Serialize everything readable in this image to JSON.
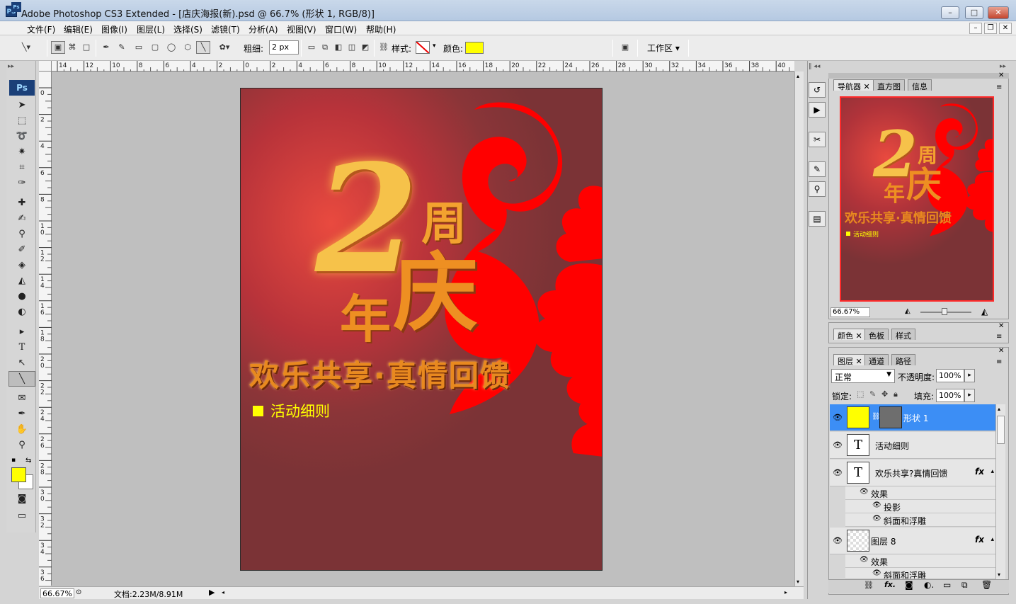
{
  "window": {
    "app_icon": "PS",
    "title": "Adobe Photoshop CS3 Extended - [店庆海报(新).psd @ 66.7% (形状 1, RGB/8)]",
    "min_label": "–",
    "max_label": "□",
    "close_label": "✕"
  },
  "menu": {
    "items": [
      "文件(F)",
      "编辑(E)",
      "图像(I)",
      "图层(L)",
      "选择(S)",
      "滤镜(T)",
      "分析(A)",
      "视图(V)",
      "窗口(W)",
      "帮助(H)"
    ],
    "doc_buttons": [
      "–",
      "❐",
      "✕"
    ]
  },
  "options": {
    "weight_label": "粗细:",
    "weight_value": "2 px",
    "style_label": "样式:",
    "color_label": "颜色:",
    "color_swatch": "#ffff00",
    "workspace_label": "工作区 ▾"
  },
  "ruler": {
    "h_ticks": [
      "14",
      "12",
      "10",
      "8",
      "6",
      "4",
      "2",
      "0",
      "2",
      "4",
      "6",
      "8",
      "10",
      "12",
      "14",
      "16",
      "18",
      "20",
      "22",
      "24",
      "26",
      "28",
      "30",
      "32",
      "34",
      "36",
      "38",
      "40"
    ],
    "v_ticks": [
      "0",
      "2",
      "4",
      "6",
      "8",
      "10",
      "12",
      "14",
      "16",
      "18",
      "20",
      "22",
      "24",
      "26",
      "28",
      "30",
      "32",
      "34",
      "36"
    ]
  },
  "poster": {
    "headline_number": "2",
    "headline_zhou": "周",
    "headline_nian": "年",
    "headline_qing": "庆",
    "slogan": "欢乐共享·真情回馈",
    "detail_text": "活动细则",
    "bg_color": "#8a3538",
    "cloud_color": "#ff0000",
    "gold_color": "#f5a623"
  },
  "status": {
    "zoom": "66.67%",
    "doc_info": "文档:2.23M/8.91M"
  },
  "navigator": {
    "tabs": [
      "导航器",
      "直方图",
      "信息"
    ],
    "zoom": "66.67%"
  },
  "color_panel": {
    "tabs": [
      "颜色",
      "色板",
      "样式"
    ]
  },
  "layers_panel": {
    "tabs": [
      "图层",
      "通道",
      "路径"
    ],
    "blend_mode": "正常",
    "opacity_label": "不透明度:",
    "opacity_value": "100%",
    "lock_label": "锁定:",
    "fill_label": "填充:",
    "fill_value": "100%",
    "layers": [
      {
        "name": "形状 1",
        "thumb": "",
        "fx": ""
      },
      {
        "name": "活动细则",
        "thumb": "T",
        "fx": ""
      },
      {
        "name": "欢乐共享?真情回馈",
        "thumb": "T",
        "fx": "fx"
      },
      {
        "name": "图层 8",
        "thumb": "",
        "fx": "fx"
      }
    ],
    "effects_label": "效果",
    "effect_shadow": "投影",
    "effect_bevel": "斜面和浮雕",
    "effects_label_2": "效果",
    "effect_bevel_2": "斜面和浮雕"
  },
  "tools": {
    "ps_label": "Ps",
    "foreground_color": "#ffff00",
    "background_color": "#ffffff"
  }
}
